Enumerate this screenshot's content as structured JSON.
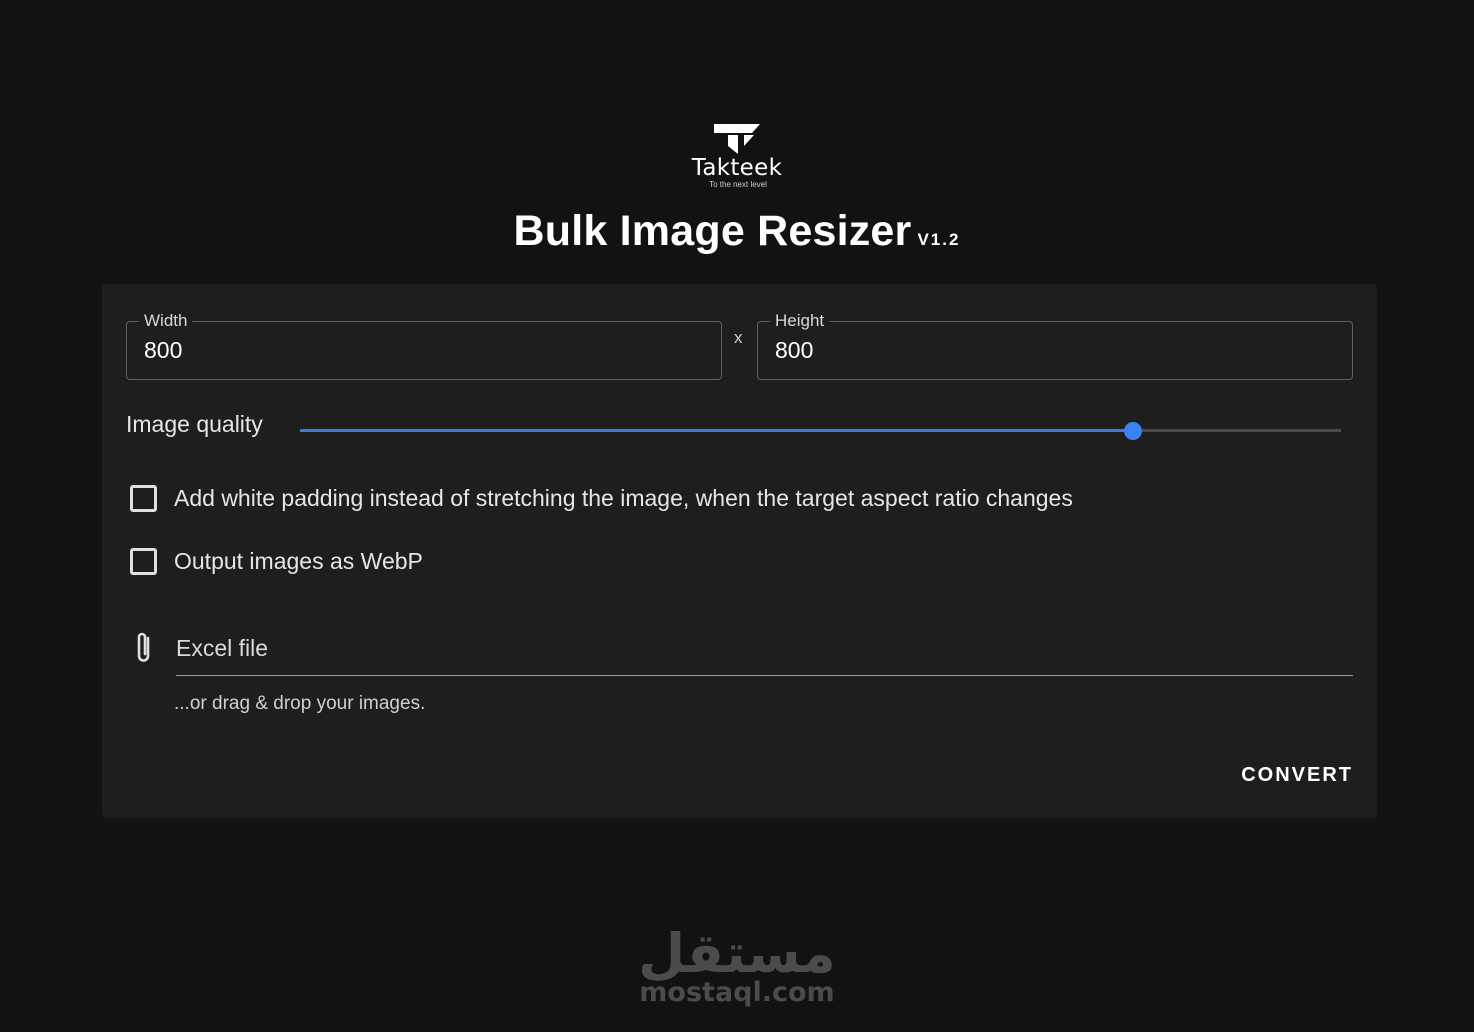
{
  "brand": {
    "name": "Takteek",
    "tagline": "To the next level"
  },
  "header": {
    "title": "Bulk Image Resizer",
    "version": "V1.2"
  },
  "form": {
    "width": {
      "label": "Width",
      "value": "800"
    },
    "separator": "x",
    "height": {
      "label": "Height",
      "value": "800"
    },
    "quality": {
      "label": "Image quality",
      "value_fraction": 0.8
    },
    "options": [
      {
        "label": "Add white padding instead of stretching the image, when the target aspect ratio changes",
        "checked": false
      },
      {
        "label": "Output images as WebP",
        "checked": false
      }
    ],
    "file": {
      "label": "Excel file",
      "hint": "...or drag & drop your images."
    },
    "convert_label": "CONVERT"
  },
  "watermark": {
    "arabic": "مستقل",
    "latin": "mostaql.com"
  },
  "colors": {
    "background": "#121212",
    "card": "#1e1e1e",
    "accent": "#3b82f0"
  }
}
